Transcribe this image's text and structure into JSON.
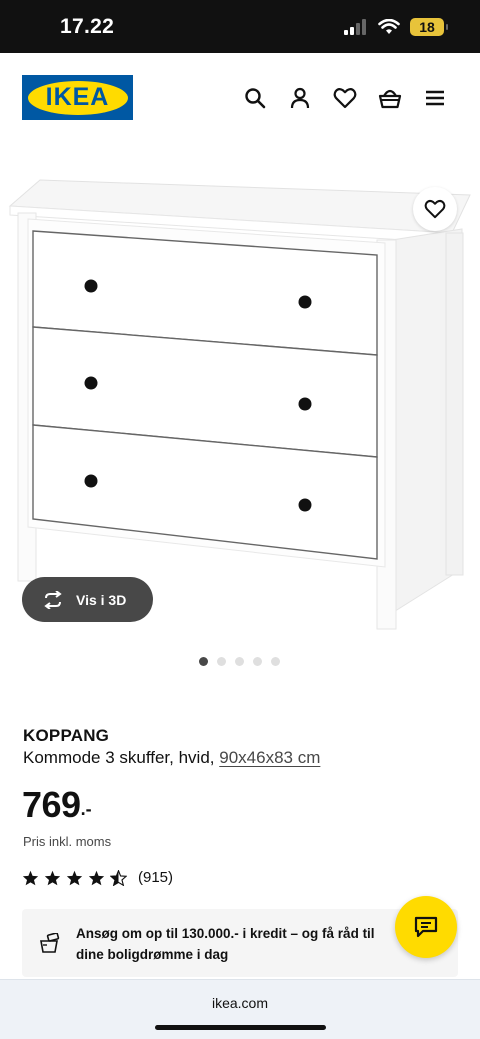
{
  "status_bar": {
    "time": "17.22",
    "battery": "18"
  },
  "header": {
    "logo_text": "IKEA",
    "icons": [
      "search-icon",
      "user-icon",
      "heart-icon",
      "basket-icon",
      "menu-icon"
    ]
  },
  "gallery": {
    "view_3d_label": "Vis i 3D",
    "image_count": 5,
    "active_image": 1
  },
  "product": {
    "name": "KOPPANG",
    "description": "Kommode 3 skuffer, hvid,",
    "dimensions": "90x46x83 cm",
    "price": "769",
    "price_suffix": ".-",
    "price_note": "Pris inkl. moms",
    "rating": 4.5,
    "review_count": "(915)"
  },
  "credit_banner": {
    "text": "Ansøg om op til 130.000.- i kredit – og få råd til dine boligdrømme i dag"
  },
  "browser": {
    "url": "ikea.com"
  },
  "colors": {
    "ikea_blue": "#0058a3",
    "ikea_yellow": "#ffdb00",
    "pill_dark": "#484848"
  }
}
